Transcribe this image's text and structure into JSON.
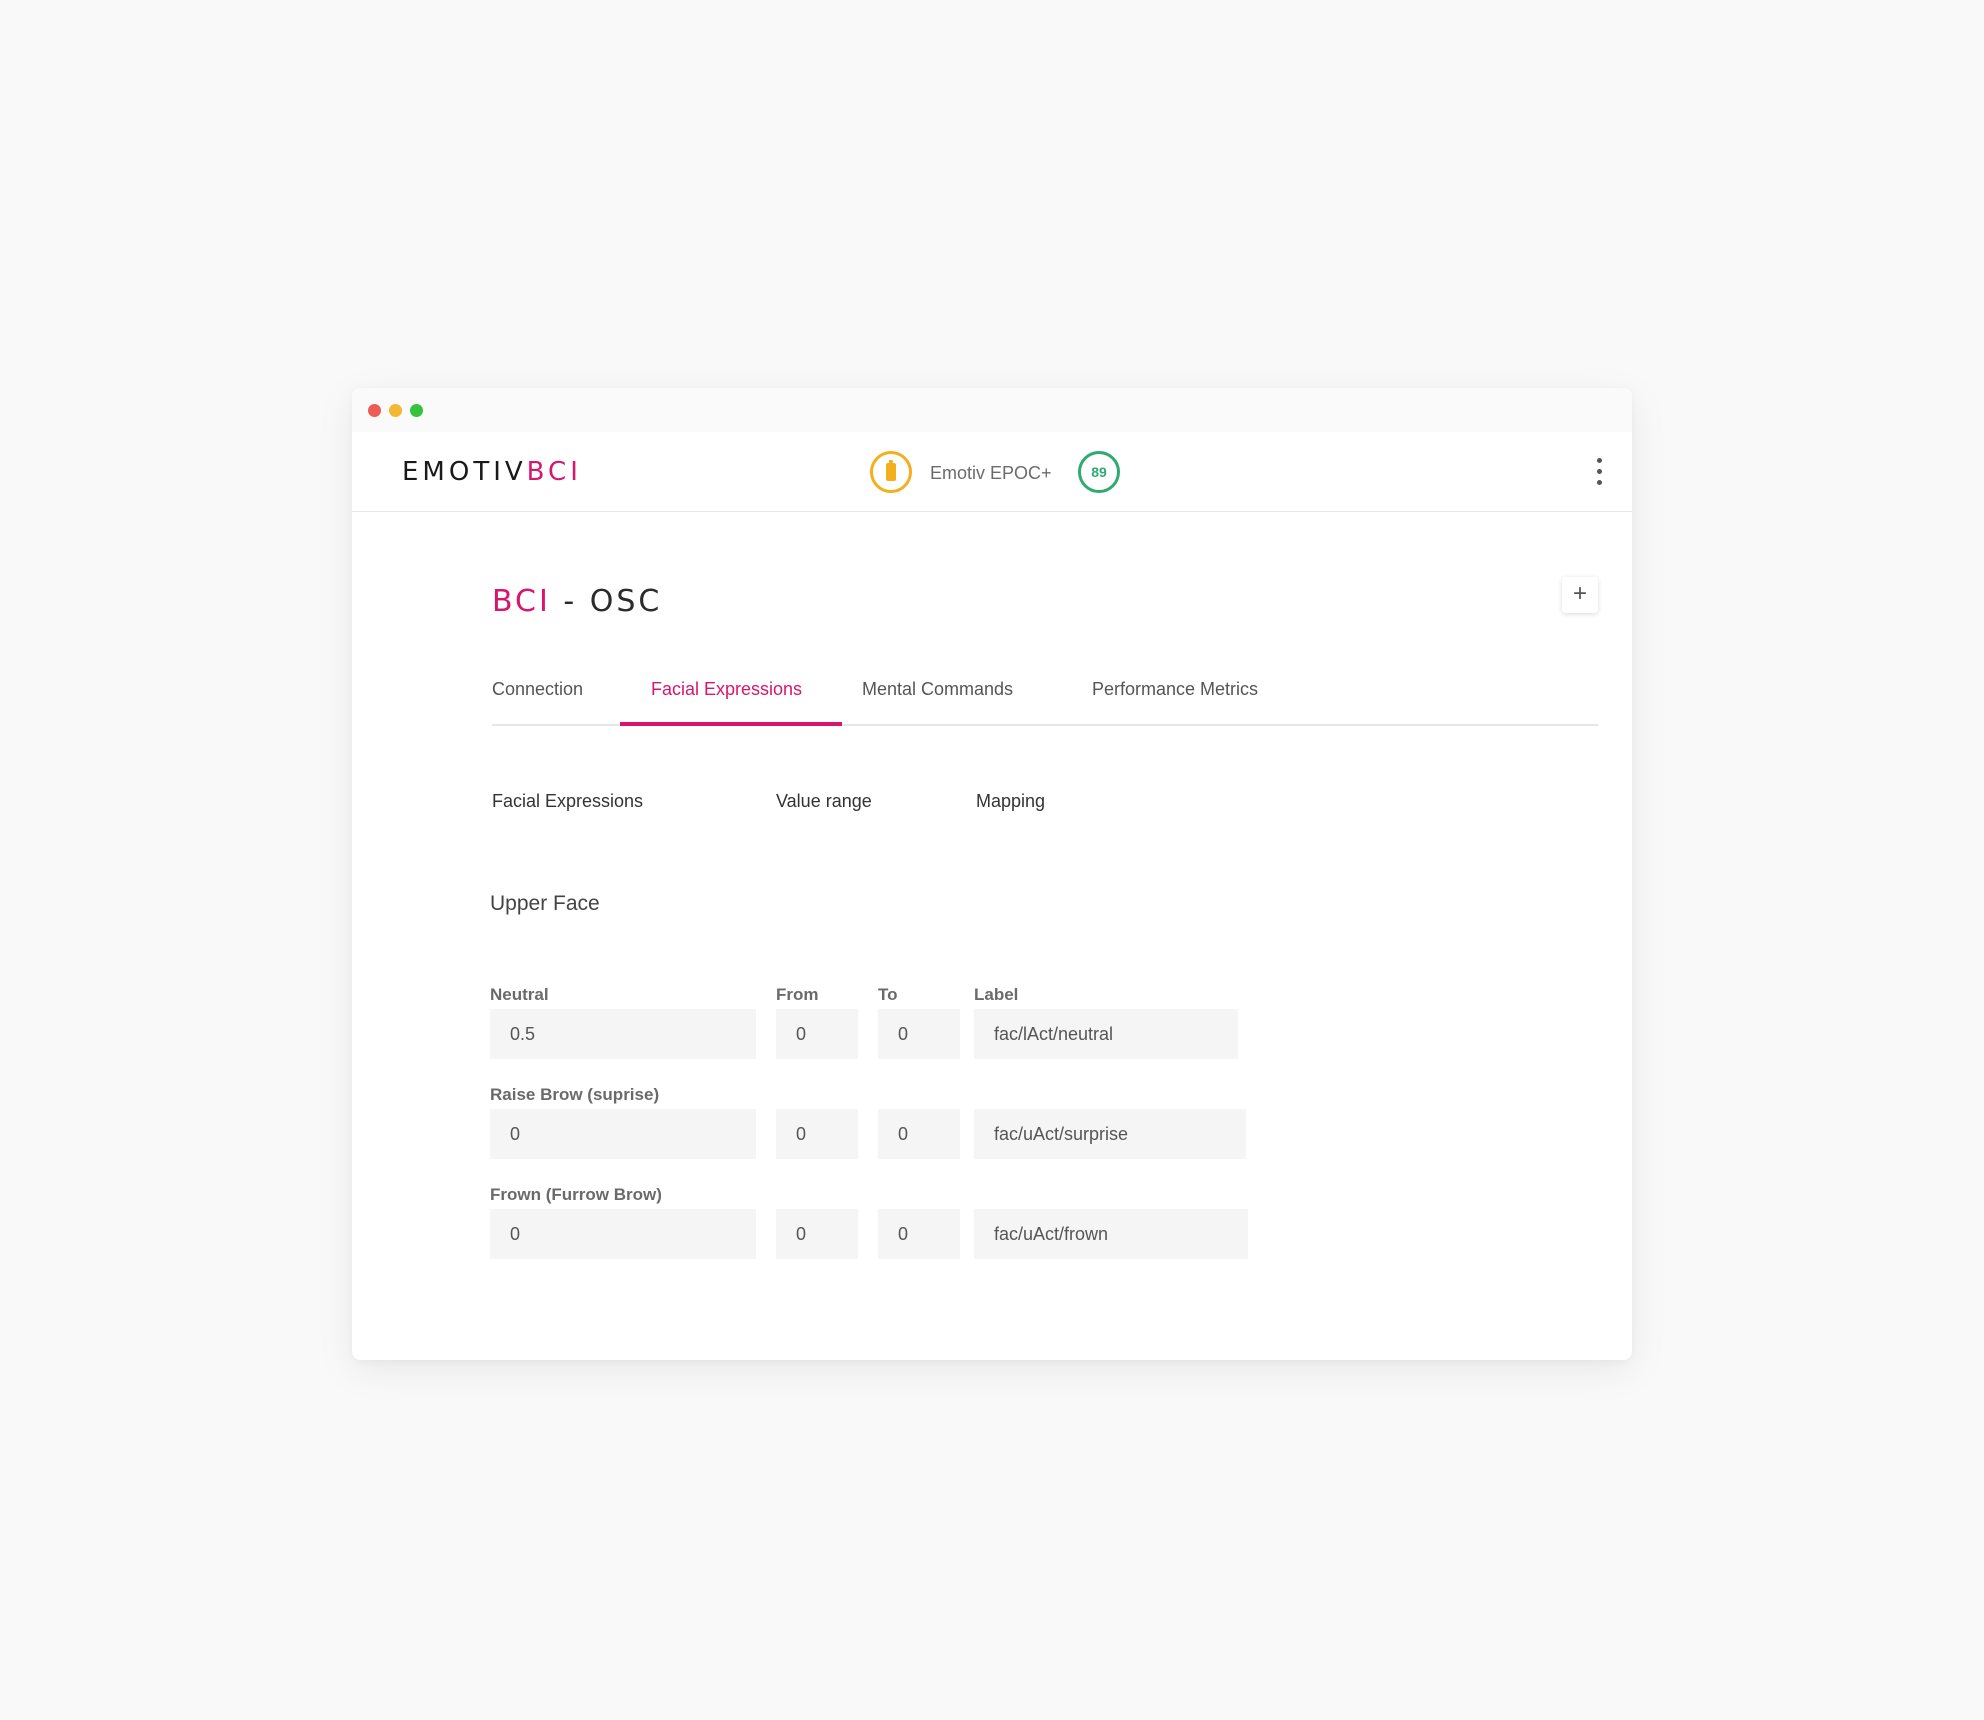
{
  "window": {
    "controls": {
      "close_color": "#ed5b52",
      "minimize_color": "#f4b731",
      "maximize_color": "#36c23e"
    }
  },
  "header": {
    "logo": {
      "part1": "EMOTIV",
      "part2": "BCI"
    },
    "battery_icon": "battery-icon",
    "device_name": "Emotiv EPOC+",
    "signal_quality": "89",
    "menu_icon": "kebab-menu-icon"
  },
  "page": {
    "title_part1": "BCI",
    "title_part2": " - OSC",
    "add_label": "+"
  },
  "tabs": [
    {
      "label": "Connection",
      "active": false
    },
    {
      "label": "Facial Expressions",
      "active": true
    },
    {
      "label": "Mental Commands",
      "active": false
    },
    {
      "label": "Performance Metrics",
      "active": false
    }
  ],
  "columns": {
    "expressions": "Facial Expressions",
    "value_range": "Value range",
    "mapping": "Mapping"
  },
  "section": {
    "title": "Upper Face",
    "headers": {
      "from": "From",
      "to": "To",
      "label": "Label"
    },
    "rows": [
      {
        "name": "Neutral",
        "value": "0.5",
        "from": "0",
        "to": "0",
        "label": "fac/lAct/neutral"
      },
      {
        "name": "Raise Brow (suprise)",
        "value": "0",
        "from": "0",
        "to": "0",
        "label": "fac/uAct/surprise"
      },
      {
        "name": "Frown (Furrow Brow)",
        "value": "0",
        "from": "0",
        "to": "0",
        "label": "fac/uAct/frown"
      }
    ]
  },
  "colors": {
    "brand": "#d7166e",
    "battery": "#f2b01e",
    "signal": "#2eaa74",
    "field_bg": "#f5f5f5"
  }
}
